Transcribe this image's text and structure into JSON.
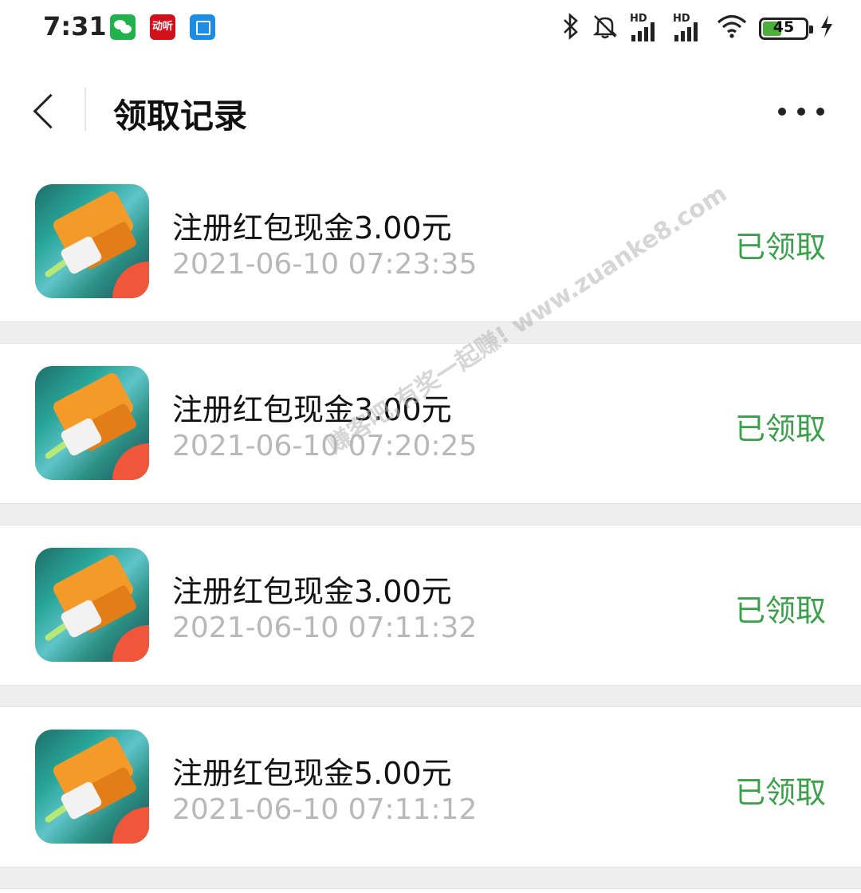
{
  "status_bar": {
    "time": "7:31",
    "app_icons": [
      "wechat-icon",
      "news-app-icon",
      "edit-app-icon"
    ],
    "news_icon_text": "动听",
    "signal_1_label": "HD",
    "signal_2_label": "HD",
    "battery_level": "45",
    "battery_fraction": 0.45
  },
  "header": {
    "title": "领取记录"
  },
  "records": [
    {
      "title": "注册红包现金3.00元",
      "time": "2021-06-10 07:23:35",
      "status": "已领取"
    },
    {
      "title": "注册红包现金3.00元",
      "time": "2021-06-10 07:20:25",
      "status": "已领取"
    },
    {
      "title": "注册红包现金3.00元",
      "time": "2021-06-10 07:11:32",
      "status": "已领取"
    },
    {
      "title": "注册红包现金5.00元",
      "time": "2021-06-10 07:11:12",
      "status": "已领取"
    }
  ],
  "watermark": "赚客吧,有奖一起赚! www.zuanke8.com",
  "colors": {
    "status_green": "#3aa14a",
    "time_gray": "#b8b8b8",
    "separator": "#eeeeee"
  }
}
